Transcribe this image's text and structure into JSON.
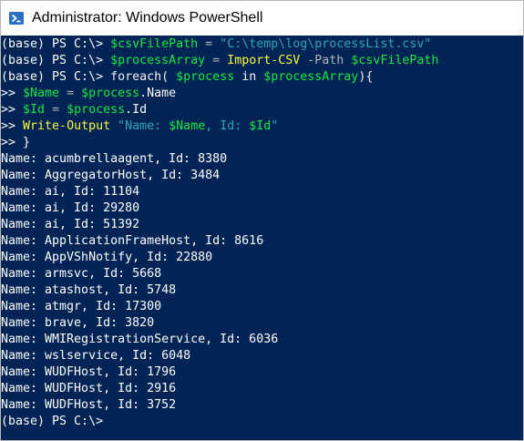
{
  "window": {
    "title": "Administrator: Windows PowerShell",
    "icon": "powershell-icon",
    "console_background": "#012456",
    "colors": {
      "default": "#ffffff",
      "variable": "#12e83f",
      "string": "#2da6b4",
      "cmdlet": "#fafa3c",
      "parameter": "#b4b4b4",
      "operator": "#b4b4b4"
    }
  },
  "console": {
    "lines": [
      {
        "segments": [
          {
            "t": "(base) PS C:\\> ",
            "c": "default"
          },
          {
            "t": "$csvFilePath",
            "c": "var"
          },
          {
            "t": " = ",
            "c": "op"
          },
          {
            "t": "\"C:\\temp\\log\\processList.csv\"",
            "c": "string"
          }
        ]
      },
      {
        "segments": [
          {
            "t": "(base) PS C:\\> ",
            "c": "default"
          },
          {
            "t": "$processArray",
            "c": "var"
          },
          {
            "t": " = ",
            "c": "op"
          },
          {
            "t": "Import-CSV",
            "c": "cmdlet"
          },
          {
            "t": " -Path ",
            "c": "param"
          },
          {
            "t": "$csvFilePath",
            "c": "var"
          }
        ]
      },
      {
        "segments": [
          {
            "t": "(base) PS C:\\> ",
            "c": "default"
          },
          {
            "t": "foreach( ",
            "c": "keyword"
          },
          {
            "t": "$process",
            "c": "var"
          },
          {
            "t": " in ",
            "c": "keyword"
          },
          {
            "t": "$processArray",
            "c": "var"
          },
          {
            "t": "){",
            "c": "keyword"
          }
        ]
      },
      {
        "segments": [
          {
            "t": ">> ",
            "c": "default"
          },
          {
            "t": "$Name",
            "c": "var"
          },
          {
            "t": " = ",
            "c": "op"
          },
          {
            "t": "$process",
            "c": "var"
          },
          {
            "t": ".Name",
            "c": "default"
          }
        ]
      },
      {
        "segments": [
          {
            "t": ">> ",
            "c": "default"
          },
          {
            "t": "$Id",
            "c": "var"
          },
          {
            "t": " = ",
            "c": "op"
          },
          {
            "t": "$process",
            "c": "var"
          },
          {
            "t": ".Id",
            "c": "default"
          }
        ]
      },
      {
        "segments": [
          {
            "t": ">> ",
            "c": "default"
          },
          {
            "t": "Write-Output",
            "c": "cmdlet"
          },
          {
            "t": " ",
            "c": "default"
          },
          {
            "t": "\"Name: ",
            "c": "string"
          },
          {
            "t": "$Name",
            "c": "var"
          },
          {
            "t": ", Id: ",
            "c": "string"
          },
          {
            "t": "$Id",
            "c": "var"
          },
          {
            "t": "\"",
            "c": "string"
          }
        ]
      },
      {
        "segments": [
          {
            "t": ">> }",
            "c": "default"
          }
        ]
      },
      {
        "segments": [
          {
            "t": "Name: acumbrellaagent, Id: 8380",
            "c": "default"
          }
        ]
      },
      {
        "segments": [
          {
            "t": "Name: AggregatorHost, Id: 3484",
            "c": "default"
          }
        ]
      },
      {
        "segments": [
          {
            "t": "Name: ai, Id: 11104",
            "c": "default"
          }
        ]
      },
      {
        "segments": [
          {
            "t": "Name: ai, Id: 29280",
            "c": "default"
          }
        ]
      },
      {
        "segments": [
          {
            "t": "Name: ai, Id: 51392",
            "c": "default"
          }
        ]
      },
      {
        "segments": [
          {
            "t": "Name: ApplicationFrameHost, Id: 8616",
            "c": "default"
          }
        ]
      },
      {
        "segments": [
          {
            "t": "Name: AppVShNotify, Id: 22880",
            "c": "default"
          }
        ]
      },
      {
        "segments": [
          {
            "t": "Name: armsvc, Id: 5668",
            "c": "default"
          }
        ]
      },
      {
        "segments": [
          {
            "t": "Name: atashost, Id: 5748",
            "c": "default"
          }
        ]
      },
      {
        "segments": [
          {
            "t": "Name: atmgr, Id: 17300",
            "c": "default"
          }
        ]
      },
      {
        "segments": [
          {
            "t": "Name: brave, Id: 3820",
            "c": "default"
          }
        ]
      },
      {
        "segments": [
          {
            "t": "Name: WMIRegistrationService, Id: 6036",
            "c": "default"
          }
        ]
      },
      {
        "segments": [
          {
            "t": "Name: wslservice, Id: 6048",
            "c": "default"
          }
        ]
      },
      {
        "segments": [
          {
            "t": "Name: WUDFHost, Id: 1796",
            "c": "default"
          }
        ]
      },
      {
        "segments": [
          {
            "t": "Name: WUDFHost, Id: 2916",
            "c": "default"
          }
        ]
      },
      {
        "segments": [
          {
            "t": "Name: WUDFHost, Id: 3752",
            "c": "default"
          }
        ]
      },
      {
        "segments": [
          {
            "t": "(base) PS C:\\>",
            "c": "default"
          }
        ]
      }
    ]
  }
}
